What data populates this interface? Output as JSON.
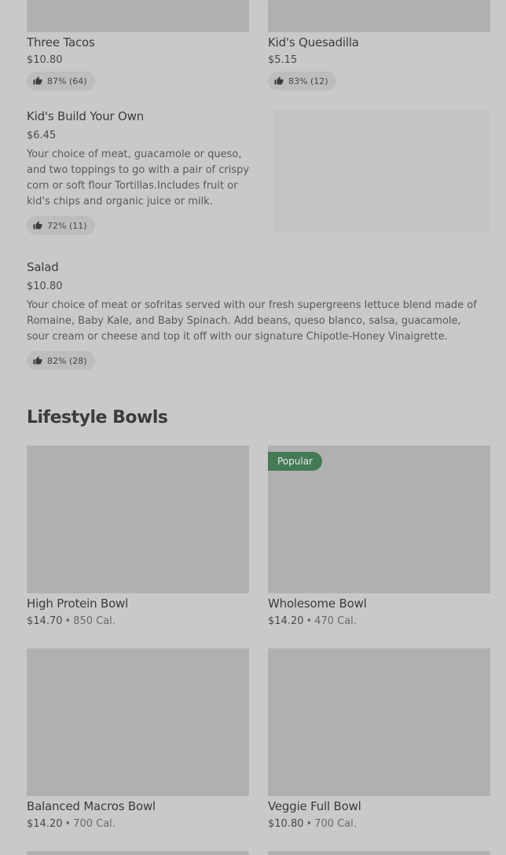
{
  "top_items": [
    {
      "name": "Three Tacos",
      "price": "$10.80",
      "rating": "87% (64)"
    },
    {
      "name": "Kid's Quesadilla",
      "price": "$5.15",
      "rating": "83% (12)"
    }
  ],
  "kids_byo": {
    "name": "Kid's Build Your Own",
    "price": "$6.45",
    "desc": "Your choice of meat, guacamole or queso, and two toppings to go with a pair of crispy corn or soft flour Tortillas.Includes fruit or kid's chips and organic juice or milk.",
    "rating": "72% (11)"
  },
  "salad": {
    "name": "Salad",
    "price": "$10.80",
    "desc": "Your choice of meat or sofritas served with our fresh supergreens lettuce blend made of Romaine, Baby Kale, and Baby Spinach. Add beans, queso blanco, salsa, guacamole, sour cream or cheese and top it off with our signature Chipotle-Honey Vinaigrette.",
    "rating": "82% (28)"
  },
  "lifestyle": {
    "title": "Lifestyle Bowls",
    "separator": "•",
    "items": [
      {
        "name": "High Protein Bowl",
        "price": "$14.70",
        "cal": "850 Cal."
      },
      {
        "name": "Wholesome Bowl",
        "price": "$14.20",
        "cal": "470 Cal.",
        "badge": "Popular"
      },
      {
        "name": "Balanced Macros Bowl",
        "price": "$14.20",
        "cal": "700 Cal."
      },
      {
        "name": "Veggie Full Bowl",
        "price": "$10.80",
        "cal": "700 Cal."
      }
    ]
  },
  "colors": {
    "background": "#c9c9c9",
    "image_placeholder": "#b0b0b0",
    "badge": "#447a55"
  },
  "icons": {
    "rating": "thumbs-up-icon"
  }
}
